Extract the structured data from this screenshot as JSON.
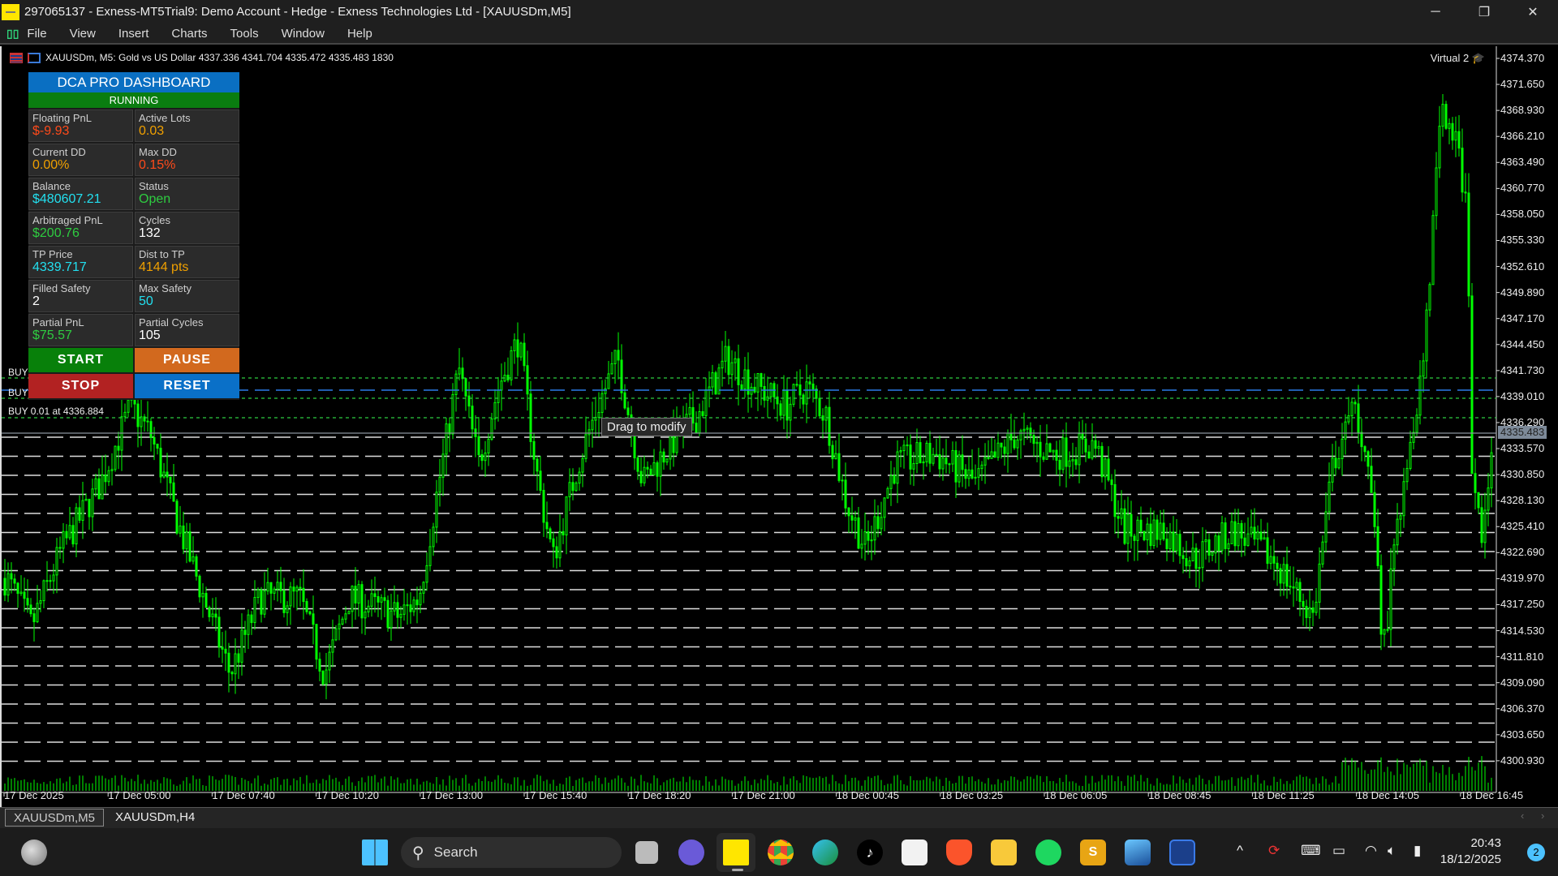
{
  "window": {
    "title": "297065137 - Exness-MT5Trial9: Demo Account - Hedge - Exness Technologies Ltd - [XAUUSDm,M5]",
    "minimize": "─",
    "restore": "❐",
    "close": "✕"
  },
  "menu": [
    "File",
    "View",
    "Insert",
    "Charts",
    "Tools",
    "Window",
    "Help"
  ],
  "chart": {
    "symbol_line": "XAUUSDm, M5:  Gold vs US Dollar  4337.336 4341.704 4335.472 4335.483  1830",
    "virtual": "Virtual 2",
    "price_axis": [
      "4374.370",
      "4371.650",
      "4368.930",
      "4366.210",
      "4363.490",
      "4360.770",
      "4358.050",
      "4355.330",
      "4352.610",
      "4349.890",
      "4347.170",
      "4344.450",
      "4341.730",
      "4339.010",
      "4336.290",
      "4333.570",
      "4330.850",
      "4328.130",
      "4325.410",
      "4322.690",
      "4319.970",
      "4317.250",
      "4314.530",
      "4311.810",
      "4309.090",
      "4306.370",
      "4303.650",
      "4300.930"
    ],
    "current_price": "4335.483",
    "time_axis": [
      "17 Dec 2025",
      "17 Dec 05:00",
      "17 Dec 07:40",
      "17 Dec 10:20",
      "17 Dec 13:00",
      "17 Dec 15:40",
      "17 Dec 18:20",
      "17 Dec 21:00",
      "18 Dec 00:45",
      "18 Dec 03:25",
      "18 Dec 06:05",
      "18 Dec 08:45",
      "18 Dec 11:25",
      "18 Dec 14:05",
      "18 Dec 16:45"
    ],
    "orders": [
      "BUY",
      "BUY",
      "BUY 0.01 at 4336.884"
    ],
    "tooltip": "Drag to modify",
    "candle_color": "#00ff00",
    "price_path": [
      4320,
      4315,
      4323,
      4330,
      4338,
      4335,
      4325,
      4316,
      4310,
      4318,
      4318,
      4310,
      4318,
      4316,
      4318,
      4330,
      4342,
      4332,
      4340,
      4345,
      4330,
      4322,
      4332,
      4338,
      4343,
      4330,
      4335,
      4337,
      4343,
      4340,
      4338,
      4340,
      4337,
      4328,
      4323,
      4332,
      4333,
      4330,
      4335,
      4333,
      4334,
      4325,
      4325,
      4322,
      4325,
      4322,
      4316,
      4332,
      4338,
      4330,
      4312,
      4330,
      4342,
      4370,
      4365,
      4358,
      4330,
      4325,
      4335
    ]
  },
  "dashboard": {
    "title": "DCA PRO DASHBOARD",
    "status": "RUNNING",
    "cells": [
      {
        "label": "Floating PnL",
        "value": "$-9.93",
        "color": "#ff4a1a"
      },
      {
        "label": "Active Lots",
        "value": "0.03",
        "color": "#f0a000"
      },
      {
        "label": "Current DD",
        "value": "0.00%",
        "color": "#f0a000"
      },
      {
        "label": "Max DD",
        "value": "0.15%",
        "color": "#ff4a1a"
      },
      {
        "label": "Balance",
        "value": "$480607.21",
        "color": "#22e0f0"
      },
      {
        "label": "Status",
        "value": "Open",
        "color": "#2ecc40"
      },
      {
        "label": "Arbitraged PnL",
        "value": "$200.76",
        "color": "#2ecc40"
      },
      {
        "label": "Cycles",
        "value": "132",
        "color": "#ffffff"
      },
      {
        "label": "TP Price",
        "value": "4339.717",
        "color": "#22e0f0"
      },
      {
        "label": "Dist to TP",
        "value": "4144 pts",
        "color": "#f0a000"
      },
      {
        "label": "Filled Safety",
        "value": "2",
        "color": "#ffffff"
      },
      {
        "label": "Max Safety",
        "value": "50",
        "color": "#22e0f0"
      },
      {
        "label": "Partial PnL",
        "value": "$75.57",
        "color": "#2ecc40"
      },
      {
        "label": "Partial Cycles",
        "value": "105",
        "color": "#ffffff"
      }
    ],
    "buttons": [
      {
        "label": "START",
        "color": "#08800a"
      },
      {
        "label": "PAUSE",
        "color": "#d2691e"
      },
      {
        "label": "STOP",
        "color": "#b22222"
      },
      {
        "label": "RESET",
        "color": "#0a70c8"
      }
    ]
  },
  "tabs": [
    "XAUUSDm,M5",
    "XAUUSDm,H4"
  ],
  "taskbar": {
    "search": "Search",
    "time": "20:43",
    "date": "18/12/2025",
    "notifications": "2"
  }
}
